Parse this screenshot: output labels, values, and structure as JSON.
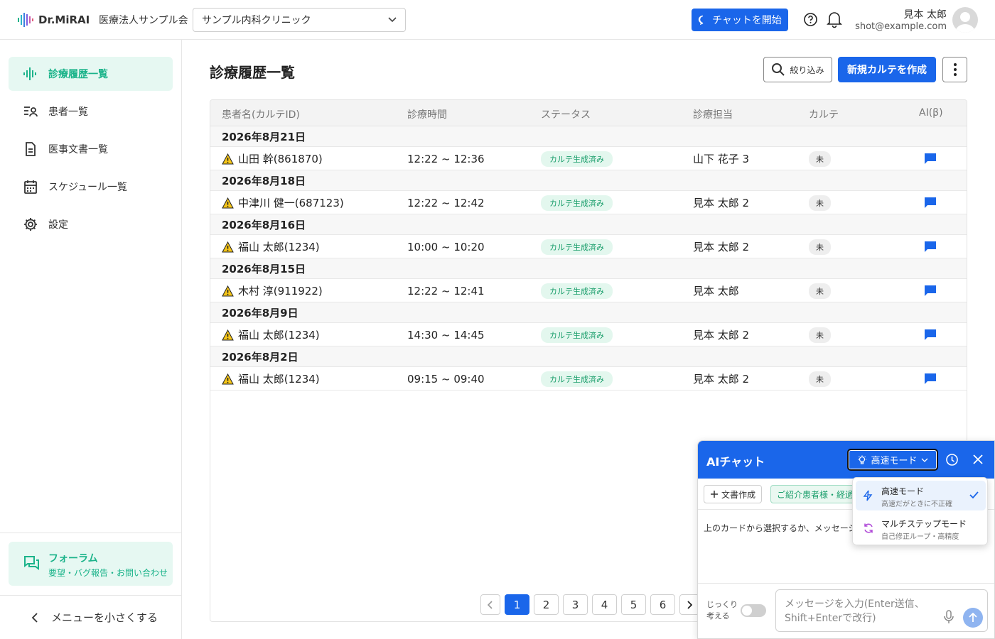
{
  "header": {
    "logo": "Dr.MiRAI",
    "org": "医療法人サンプル会",
    "clinic": "サンプル内科クリニック",
    "chat_button": "チャットを開始",
    "user_name": "見本 太郎",
    "user_email": "shot@example.com"
  },
  "sidebar": {
    "items": [
      {
        "label": "診療履歴一覧",
        "icon": "waveform-icon",
        "active": true
      },
      {
        "label": "患者一覧",
        "icon": "patient-list-icon"
      },
      {
        "label": "医事文書一覧",
        "icon": "document-icon"
      },
      {
        "label": "スケジュール一覧",
        "icon": "calendar-icon"
      },
      {
        "label": "設定",
        "icon": "gear-icon"
      }
    ],
    "forum_title": "フォーラム",
    "forum_sub": "要望・バグ報告・お問い合わせ",
    "collapse": "メニューを小さくする"
  },
  "main": {
    "title": "診療履歴一覧",
    "filter_label": "絞り込み",
    "new_button": "新規カルテを作成",
    "columns": [
      "患者名(カルテID)",
      "診療時間",
      "ステータス",
      "診療担当",
      "カルテ",
      "AI(β)"
    ],
    "groups": [
      {
        "date": "2026年8月21日",
        "patient": "山田 幹(861870)",
        "time": "12:22 ~ 12:36",
        "status": "カルテ生成済み",
        "doctor": "山下 花子 3",
        "karte": "未"
      },
      {
        "date": "2026年8月18日",
        "patient": "中津川 健一(687123)",
        "time": "12:22 ~ 12:42",
        "status": "カルテ生成済み",
        "doctor": "見本 太郎 2",
        "karte": "未"
      },
      {
        "date": "2026年8月16日",
        "patient": "福山 太郎(1234)",
        "time": "10:00 ~ 10:20",
        "status": "カルテ生成済み",
        "doctor": "見本 太郎 2",
        "karte": "未"
      },
      {
        "date": "2026年8月15日",
        "patient": "木村 淳(911922)",
        "time": "12:22 ~ 12:41",
        "status": "カルテ生成済み",
        "doctor": "見本 太郎",
        "karte": "未"
      },
      {
        "date": "2026年8月9日",
        "patient": "福山 太郎(1234)",
        "time": "14:30 ~ 14:45",
        "status": "カルテ生成済み",
        "doctor": "見本 太郎 2",
        "karte": "未"
      },
      {
        "date": "2026年8月2日",
        "patient": "福山 太郎(1234)",
        "time": "09:15 ~ 09:40",
        "status": "カルテ生成済み",
        "doctor": "見本 太郎 2",
        "karte": "未"
      }
    ],
    "pages": [
      "1",
      "2",
      "3",
      "4",
      "5",
      "6"
    ],
    "current_page": "1"
  },
  "chat": {
    "title": "AIチャット",
    "mode": "高速モード",
    "chip_doc": "文書作成",
    "chip_intro": "ご紹介患者様・経過報告",
    "hint": "上のカードから選択するか、メッセージを",
    "think_label": "じっくり考える",
    "placeholder": "メッセージを入力(Enter送信、Shift+Enterで改行)",
    "modes": [
      {
        "title": "高速モード",
        "sub": "高速だがときに不正確",
        "selected": true
      },
      {
        "title": "マルチステップモード",
        "sub": "自己修正ループ・高精度"
      }
    ]
  },
  "colors": {
    "accent": "#1a66ea",
    "green": "#1bb38a"
  }
}
